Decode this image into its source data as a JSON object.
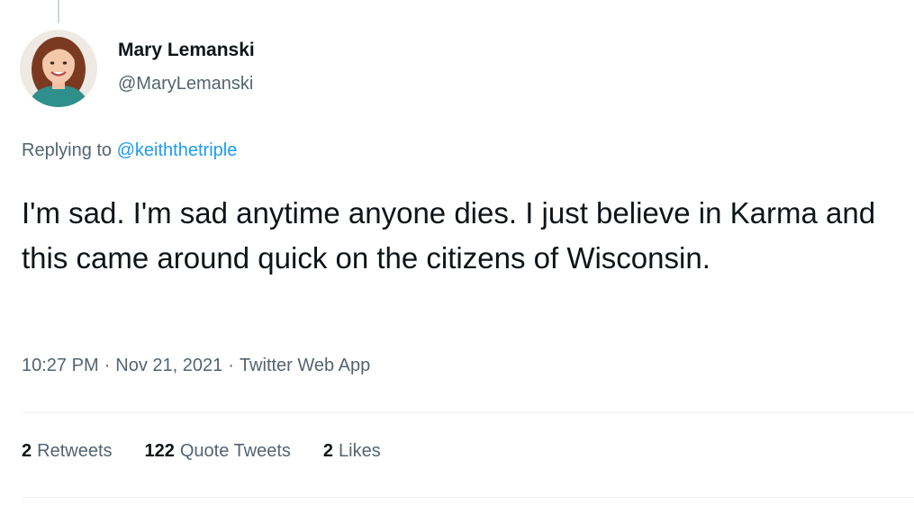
{
  "author": {
    "display_name": "Mary Lemanski",
    "handle": "@MaryLemanski"
  },
  "reply": {
    "prefix": "Replying to",
    "mention": "@keiththetriple"
  },
  "tweet": {
    "text": "I'm sad. I'm sad anytime anyone dies. I just believe in Karma and this came around quick on the citizens of Wisconsin.",
    "time": "10:27 PM",
    "date": "Nov 21, 2021",
    "source": "Twitter Web App",
    "separator": "·"
  },
  "stats": [
    {
      "count": "2",
      "label": "Retweets"
    },
    {
      "count": "122",
      "label": "Quote Tweets"
    },
    {
      "count": "2",
      "label": "Likes"
    }
  ],
  "colors": {
    "link": "#1d9bf0",
    "secondary_text": "#536471",
    "primary_text": "#0f1419"
  }
}
